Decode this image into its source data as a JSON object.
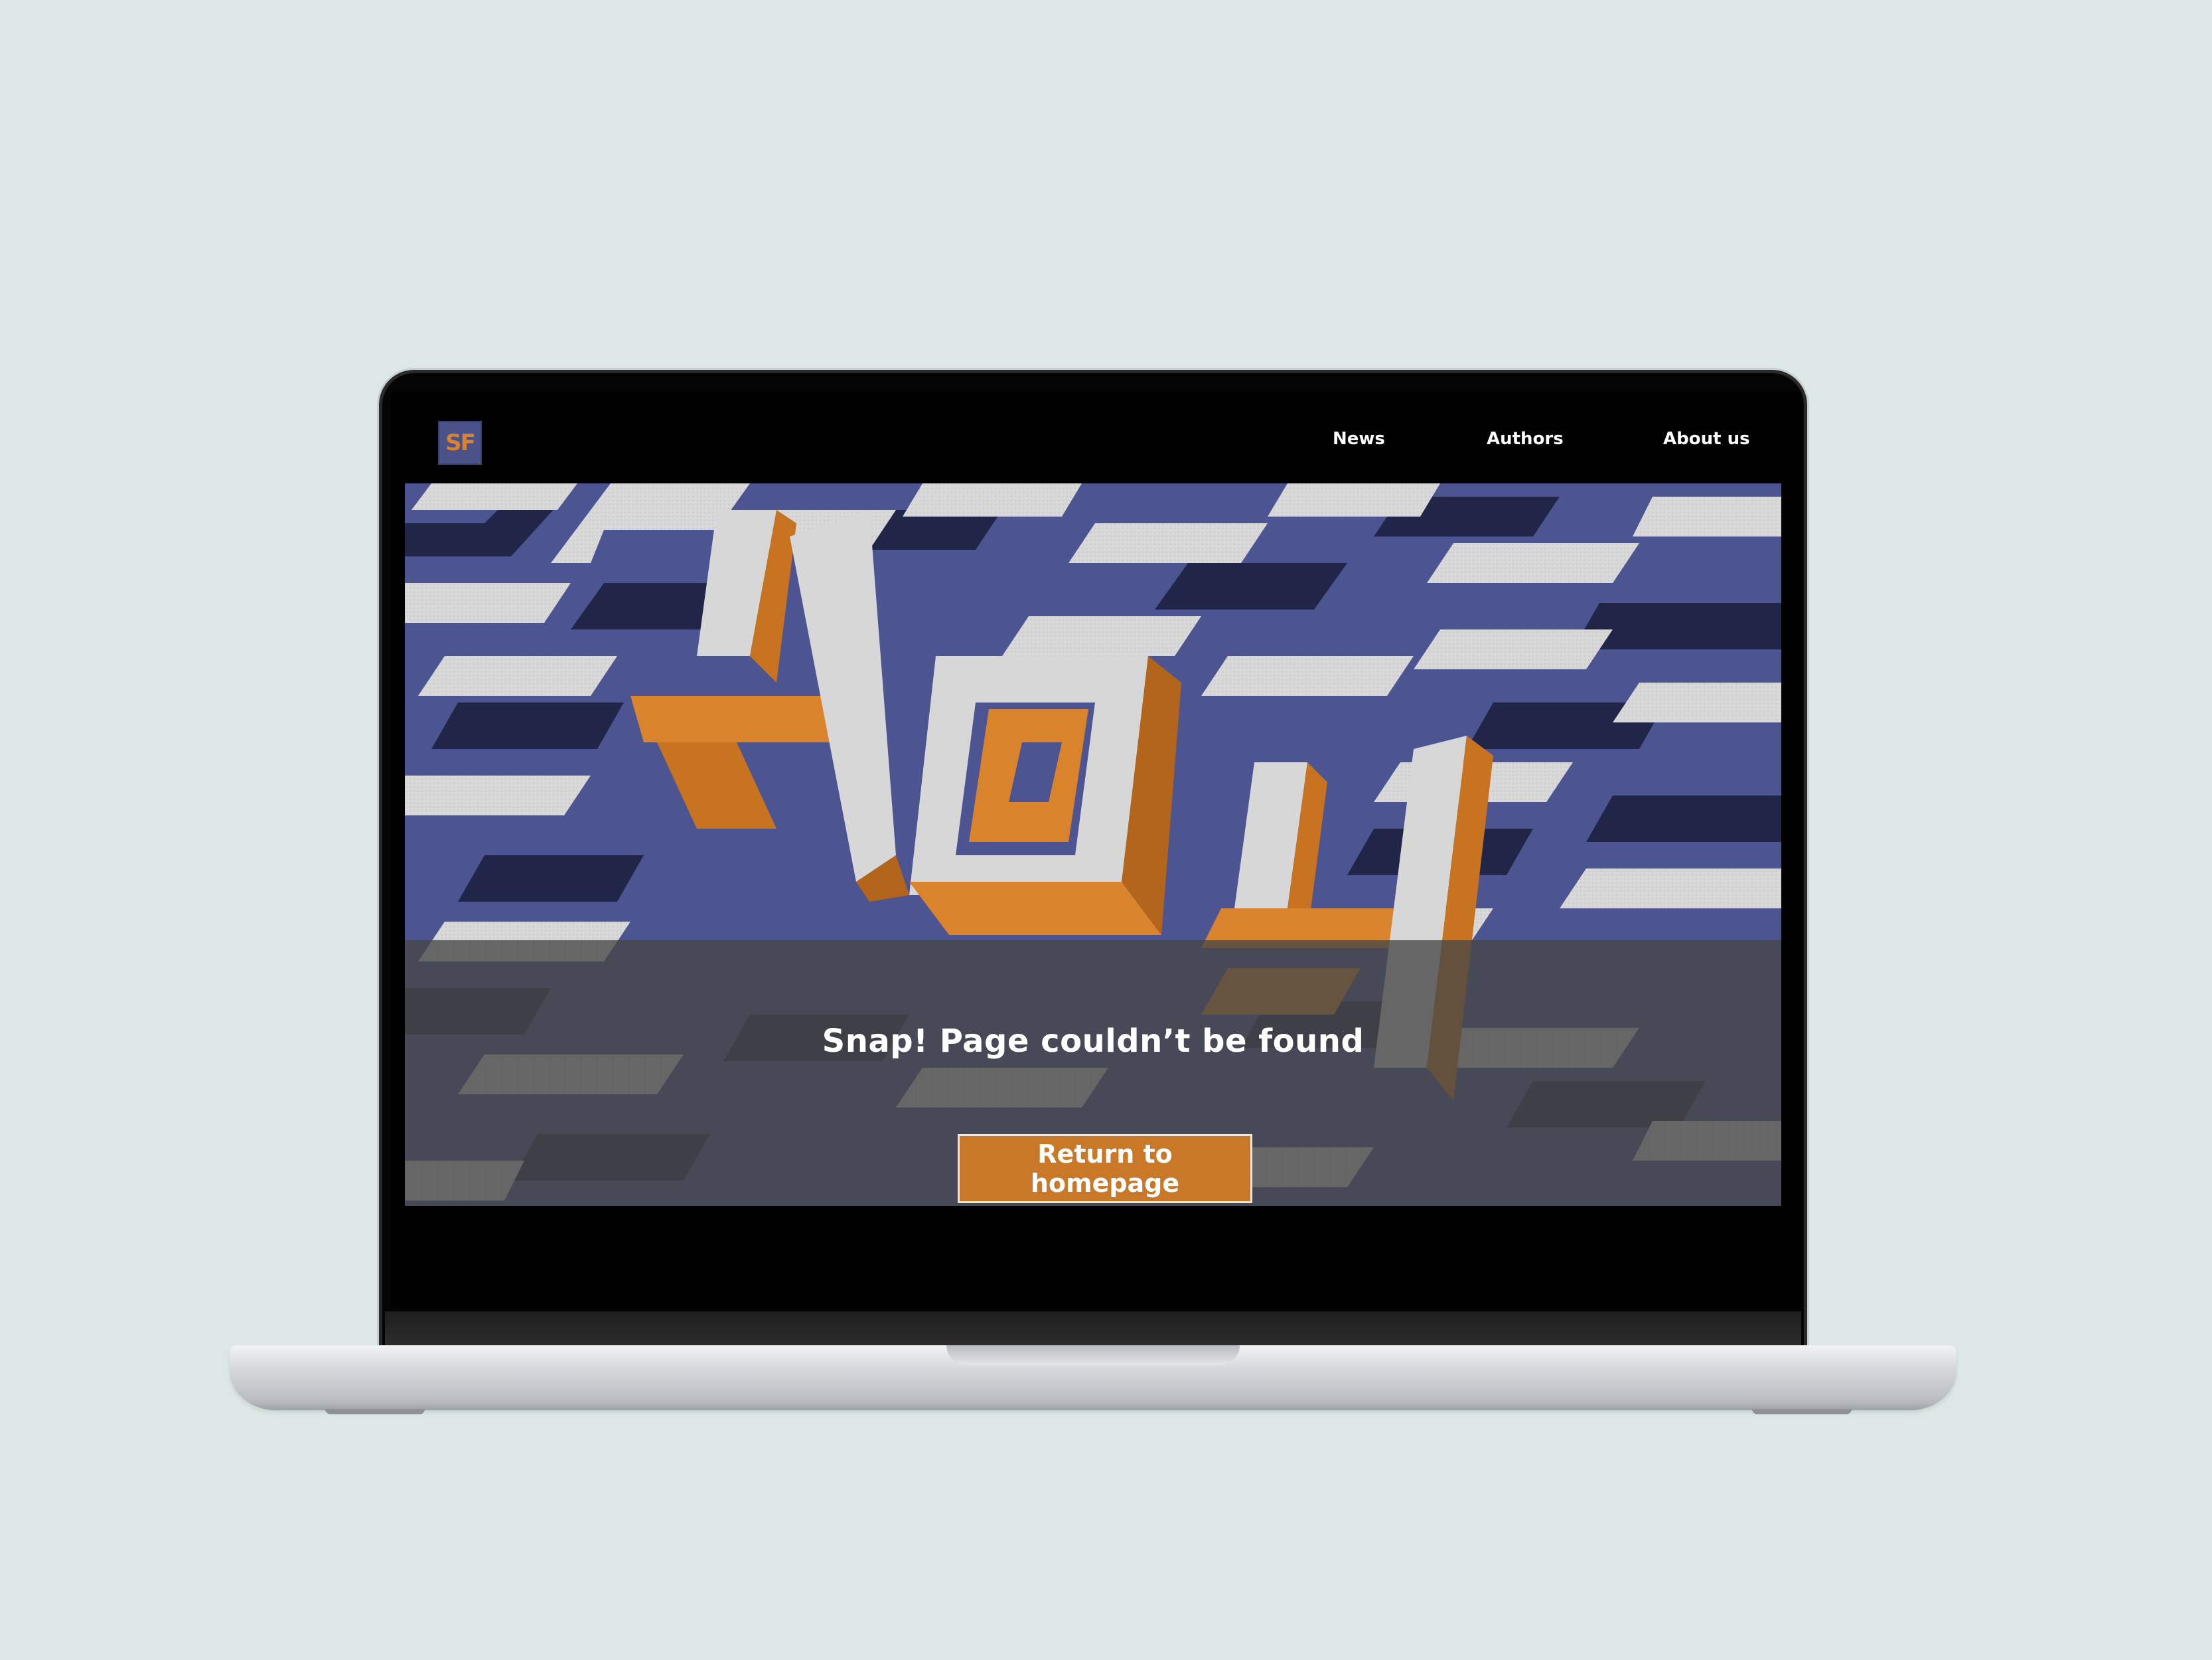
{
  "brand": {
    "logo_text": "SF",
    "colors": {
      "accent": "#c97828",
      "logo_bg": "#4b5189",
      "page_bg": "#dde7e5"
    }
  },
  "nav": {
    "items": [
      {
        "label": "News"
      },
      {
        "label": "Authors"
      },
      {
        "label": "About us"
      }
    ]
  },
  "hero": {
    "image": "3D maze illustration with orange 404 blocks",
    "headline": "Snap! Page couldn’t be found",
    "button_label": "Return to homepage"
  }
}
